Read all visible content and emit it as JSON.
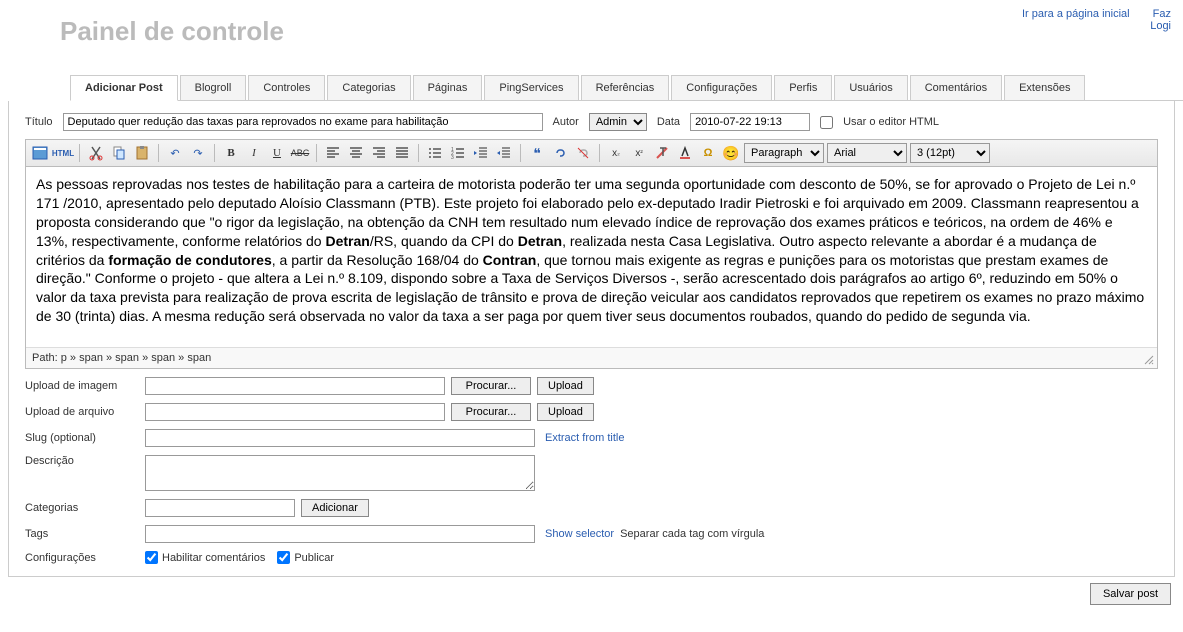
{
  "header": {
    "title": "Painel de controle",
    "home_link": "Ir para a página inicial",
    "login_link": "Faz\nLogi"
  },
  "tabs": [
    "Adicionar Post",
    "Blogroll",
    "Controles",
    "Categorias",
    "Páginas",
    "PingServices",
    "Referências",
    "Configurações",
    "Perfis",
    "Usuários",
    "Comentários",
    "Extensões"
  ],
  "meta": {
    "title_label": "Título",
    "title_value": "Deputado quer redução das taxas para reprovados no exame para habilitação",
    "author_label": "Autor",
    "author_value": "Admin",
    "date_label": "Data",
    "date_value": "2010-07-22 19:13",
    "html_editor_label": "Usar o editor HTML"
  },
  "toolbar": {
    "format": "Paragraph",
    "font": "Arial",
    "size": "3 (12pt)"
  },
  "content": {
    "p1a": "As pessoas reprovadas nos testes de habilitação para a carteira de motorista poderão ter uma segunda oportunidade com desconto de 50%, se for aprovado o Projeto de Lei n.º 171 /2010, apresentado pelo deputado Aloísio Classmann (PTB). Este projeto foi elaborado pelo ex-deputado Iradir Pietroski e foi arquivado em 2009. Classmann reapresentou a proposta considerando que \"o rigor da legislação, na obtenção da CNH tem resultado num elevado índice de reprovação dos exames práticos e teóricos, na ordem de 46% e 13%, respectivamente, conforme relatórios do ",
    "b1": "Detran",
    "p1b": "/RS, quando da CPI do ",
    "b2": "Detran",
    "p1c": ", realizada nesta Casa Legislativa. Outro aspecto relevante a abordar é a mudança de critérios da ",
    "b3": "formação de condutores",
    "p1d": ", a partir da Resolução 168/04 do ",
    "b4": "Contran",
    "p1e": ", que tornou mais exigente as regras e punições para os motoristas que prestam exames de direção.\" Conforme o projeto - que altera a Lei n.º 8.109, dispondo sobre a Taxa de Serviços Diversos -, serão acrescentado dois parágrafos ao artigo 6º, reduzindo em 50% o valor da taxa prevista para realização de prova escrita de legislação de trânsito e prova de direção veicular aos candidatos reprovados que repetirem os exames no prazo máximo de 30 (trinta) dias. A mesma redução será observada no valor da taxa a ser paga por quem tiver seus documentos roubados, quando do pedido de segunda via."
  },
  "path": "Path: p » span » span » span » span",
  "upload": {
    "img_label": "Upload de imagem",
    "file_label": "Upload de arquivo",
    "browse": "Procurar...",
    "upload": "Upload"
  },
  "slug": {
    "label": "Slug (optional)",
    "extract": "Extract from title"
  },
  "desc": {
    "label": "Descrição"
  },
  "cats": {
    "label": "Categorias",
    "add": "Adicionar"
  },
  "tags": {
    "label": "Tags",
    "selector": "Show selector",
    "hint": "Separar cada tag com vírgula"
  },
  "settings": {
    "label": "Configurações",
    "comments": "Habilitar comentários",
    "publish": "Publicar"
  },
  "save": "Salvar post"
}
